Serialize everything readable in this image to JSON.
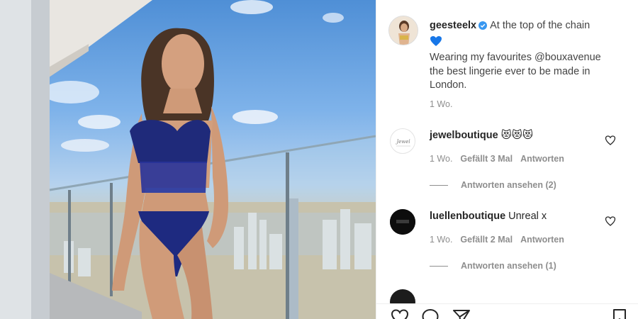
{
  "post": {
    "username": "geesteelx",
    "caption_first": "At the top of the chain",
    "caption_lines": [
      "Wearing my favourites @bouxavenue",
      "the best lingerie ever to be made in",
      "London."
    ],
    "time": "1 Wo."
  },
  "comments": [
    {
      "username": "jewelboutique",
      "text": "😻😻😻",
      "time": "1 Wo.",
      "likes": "Gefällt 3 Mal",
      "reply": "Antworten",
      "view_replies": "Antworten ansehen (2)"
    },
    {
      "username": "luellenboutique",
      "text": "Unreal x",
      "time": "1 Wo.",
      "likes": "Gefällt 2 Mal",
      "reply": "Antworten",
      "view_replies": "Antworten ansehen (1)"
    }
  ],
  "icons": {
    "verified": "verified-badge-icon",
    "heart_emoji": "blue-heart-emoji",
    "like": "heart-outline-icon",
    "comment": "comment-bubble-icon",
    "share": "paper-plane-icon",
    "save": "bookmark-icon"
  },
  "colors": {
    "verified": "#3897f0",
    "heart": "#1877e8",
    "text": "#262626",
    "meta": "#8e8e8e"
  }
}
